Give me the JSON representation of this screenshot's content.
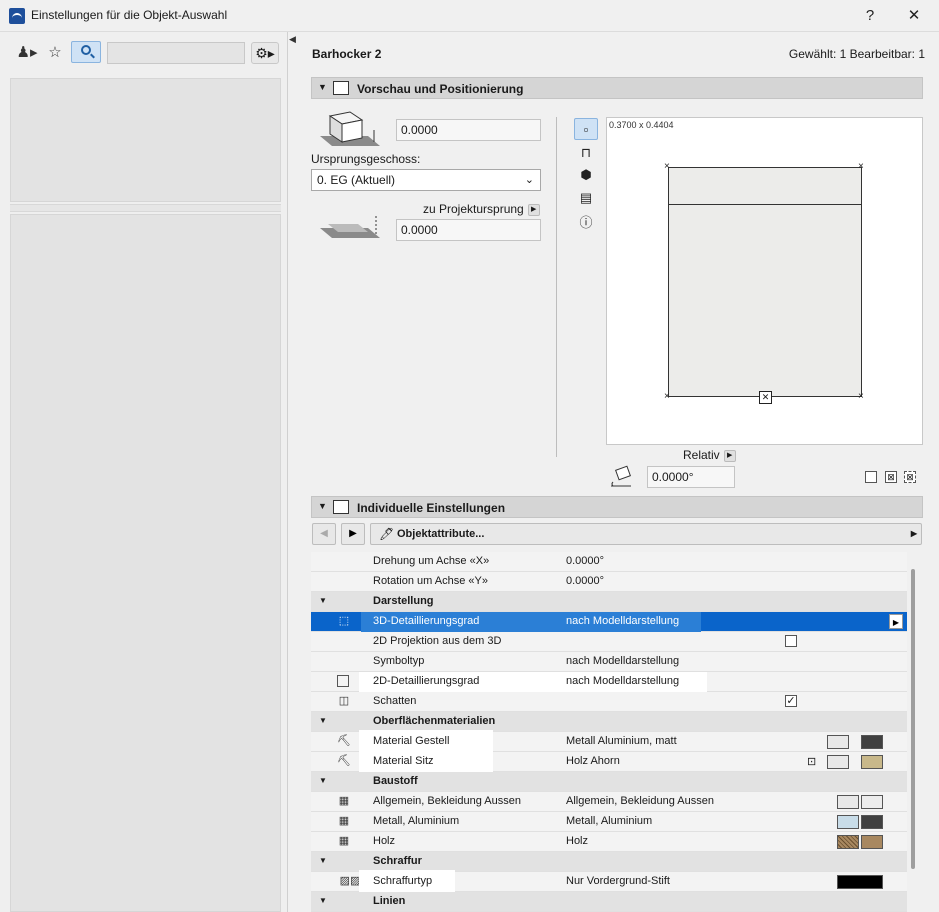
{
  "window": {
    "title": "Einstellungen für die Objekt-Auswahl",
    "help_label": "?",
    "close_label": "✕"
  },
  "header": {
    "object_name": "Barhocker 2",
    "selection_info": "Gewählt: 1 Bearbeitbar: 1"
  },
  "preview_section": {
    "title": "Vorschau und Positionierung",
    "elevation_value": "0.0000",
    "story_label": "Ursprungsgeschoss:",
    "story_value": "0. EG (Aktuell)",
    "project_origin_label": "zu Projektursprung",
    "project_origin_value": "0.0000",
    "dimensions": "0.3700 x 0.4404",
    "relative_label": "Relativ",
    "angle_value": "0.0000°"
  },
  "settings_section": {
    "title": "Individuelle Einstellungen",
    "attributes_label": "Objektattribute..."
  },
  "params": [
    {
      "name": "Drehung um Achse «X»",
      "value": "0.0000°",
      "type": "row"
    },
    {
      "name": "Rotation um Achse «Y»",
      "value": "0.0000°",
      "type": "row"
    },
    {
      "name": "Darstellung",
      "value": "",
      "type": "group"
    },
    {
      "name": "3D-Detaillierungsgrad",
      "value": "nach Modelldarstellung",
      "type": "row",
      "selected": true,
      "icon": "cube-icon"
    },
    {
      "name": "2D Projektion aus dem 3D",
      "value": "",
      "type": "row",
      "checkbox": false
    },
    {
      "name": "Symboltyp",
      "value": "nach Modelldarstellung",
      "type": "row"
    },
    {
      "name": "2D-Detaillierungsgrad",
      "value": "nach Modelldarstellung",
      "type": "row",
      "icon": "square-icon"
    },
    {
      "name": "Schatten",
      "value": "",
      "type": "row",
      "checkbox": true,
      "icon": "shadow-icon"
    },
    {
      "name": "Oberflächenmaterialien",
      "value": "",
      "type": "group"
    },
    {
      "name": "Material Gestell",
      "value": "Metall Aluminium, matt",
      "type": "row",
      "icon": "brush-icon"
    },
    {
      "name": "Material Sitz",
      "value": "Holz Ahorn",
      "type": "row",
      "icon": "brush-icon"
    },
    {
      "name": "Baustoff",
      "value": "",
      "type": "group"
    },
    {
      "name": "Allgemein, Bekleidung Aussen",
      "value": "Allgemein, Bekleidung Aussen",
      "type": "row",
      "icon": "building-material-icon"
    },
    {
      "name": "Metall, Aluminium",
      "value": "Metall, Aluminium",
      "type": "row",
      "icon": "building-material-icon"
    },
    {
      "name": "Holz",
      "value": "Holz",
      "type": "row",
      "icon": "building-material-icon"
    },
    {
      "name": "Schraffur",
      "value": "",
      "type": "group"
    },
    {
      "name": "Schraffurtyp",
      "value": "Nur Vordergrund-Stift",
      "type": "row",
      "icon": "hatch-icon"
    },
    {
      "name": "Linien",
      "value": "",
      "type": "group"
    }
  ],
  "colors": {
    "selection": "#0a64ca",
    "active_button": "#cfe2f5",
    "swatch_aluminium": "#404040",
    "swatch_maple": "#c8b88a",
    "swatch_metal_light": "#c8dce8",
    "swatch_wood": "#a88860",
    "swatch_black": "#000000"
  }
}
